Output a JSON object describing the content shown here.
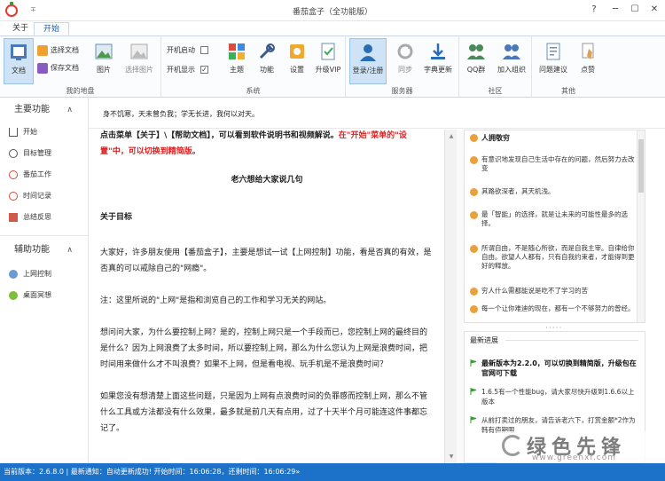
{
  "window": {
    "title": "番茄盒子（全功能版）",
    "quick_access": "∓",
    "controls": [
      "?",
      "─",
      "☐",
      "✕"
    ]
  },
  "menu": {
    "tabs": [
      "关于",
      "开始"
    ],
    "active": "开始"
  },
  "ribbon": {
    "groups": [
      {
        "label": "我的地盘",
        "big": [
          {
            "label": "文档",
            "icon": "document-icon"
          },
          {
            "label": "图片",
            "icon": "picture-icon"
          },
          {
            "label": "选择图片",
            "icon": "select-picture-icon"
          }
        ],
        "small": [
          {
            "label": "选择文档",
            "icon": "open-doc-icon"
          },
          {
            "label": "保存文档",
            "icon": "save-doc-icon"
          }
        ]
      },
      {
        "label": "系统",
        "checkboxes": [
          {
            "label": "开机启动",
            "checked": false
          },
          {
            "label": "开机显示",
            "checked": true
          }
        ],
        "big": [
          {
            "label": "主题",
            "icon": "theme-icon"
          },
          {
            "label": "功能",
            "icon": "tools-icon"
          },
          {
            "label": "设置",
            "icon": "settings-icon"
          },
          {
            "label": "升级VIP",
            "icon": "vip-icon"
          }
        ]
      },
      {
        "label": "服务器",
        "big": [
          {
            "label": "登录/注册",
            "icon": "user-icon"
          },
          {
            "label": "同步",
            "icon": "sync-icon"
          },
          {
            "label": "字典更新",
            "icon": "download-icon"
          }
        ]
      },
      {
        "label": "社区",
        "big": [
          {
            "label": "QQ群",
            "icon": "qq-group-icon"
          },
          {
            "label": "加入组织",
            "icon": "join-group-icon"
          }
        ]
      },
      {
        "label": "其他",
        "big": [
          {
            "label": "问题建议",
            "icon": "feedback-icon"
          },
          {
            "label": "点赞",
            "icon": "like-icon"
          }
        ]
      }
    ]
  },
  "sidebar": {
    "sections": [
      {
        "title": "主要功能",
        "items": [
          "开始",
          "目标管理",
          "番茄工作",
          "时间记录",
          "总结反思"
        ]
      },
      {
        "title": "辅助功能",
        "items": [
          "上网控制",
          "桌面冥想"
        ]
      }
    ]
  },
  "notice": "身不饥寒，天未曾负我；学无长进，我何以对天。",
  "doc": {
    "intro_black": "点击菜单【关于】\\【帮助文档】，可以看到软件说明书和视频解说。",
    "intro_red": "在\"开始\"菜单的\"设置\"中，可以切换到精简版。",
    "title": "老六想给大家说几句",
    "section": "关于目标",
    "p1": "大家好，许多朋友使用【番茄盒子】，主要是想试一试【上网控制】功能，看是否真的有效，是否真的可以戒除自己的\"网瘾\"。",
    "p2": "注：这里所说的\"上网\"是指和浏览自己的工作和学习无关的网站。",
    "p3": "想问问大家，为什么要控制上网？是的，控制上网只是一个手段而已，您控制上网的最终目的是什么？因为上网浪费了太多时间，所以要控制上网，那么为什么您认为上网是浪费时间，把时间用来做什么才不叫浪费？如果不上网，但是看电视、玩手机是不是浪费时间？",
    "p4": "如果您没有想清楚上面这些问题，只是因为上网有点浪费时间的负罪感而控制上网，那么不管什么工具或方法都没有什么效果，最多就是前几天有点用，过了十天半个月可能连这件事都忘记了。"
  },
  "quotes": {
    "title": "人拥敬穷",
    "items": [
      "有意识地发现自己生活中存在的问题，然后努力去改变",
      "其路欲深者，其天机浅。",
      "最「智能」的选择，就是让未来的可能性最多的选择。",
      "所谓自由，不是随心所欲，而是自我主宰。自律给你自由。欲望人人都有，只有自我约束者，才能得到更好的释放。",
      "穷人什么需都能说是吃不了学习的苦",
      "每一个让你难迪的现在，都有一个不够努力的曾经。"
    ]
  },
  "news": {
    "title": "最新进展",
    "items": [
      {
        "text": "最新版本为2.2.0，可以切换到精简版，升级包在官网可下载",
        "bold": true
      },
      {
        "text": "1.6.5有一个性能bug，请大家尽快升级到1.6.6以上版本",
        "bold": false
      },
      {
        "text": "从前打卖过的朋友，请告诉老六下，打赏金额*2作为韩有值期限",
        "bold": false
      }
    ]
  },
  "status": "当前版本：2.6.8.0  |  最新通知：自动更新成功!  开始时间：16:06:28，还剩时间：16:06:29»",
  "watermark": {
    "brand": "绿色先锋",
    "url": "www.greenxf.com"
  },
  "colors": {
    "accent": "#1b72c8",
    "red": "#e02020",
    "selected": "#cfe3f7"
  }
}
